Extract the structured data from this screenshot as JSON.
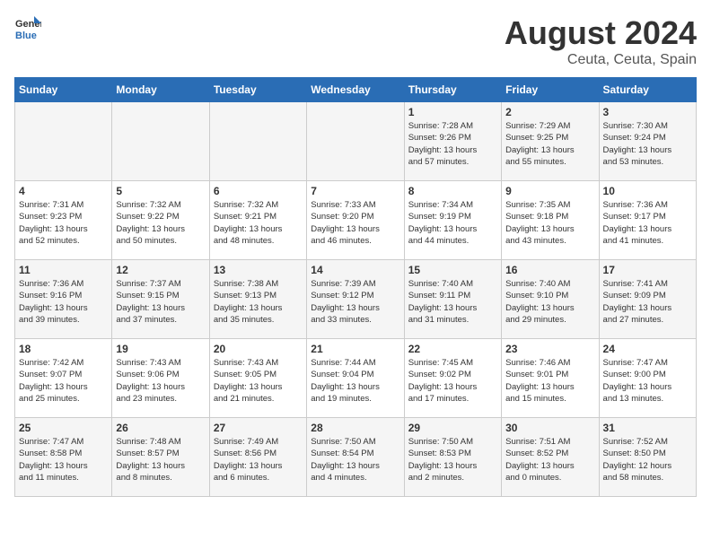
{
  "header": {
    "logo_general": "General",
    "logo_blue": "Blue",
    "month_year": "August 2024",
    "location": "Ceuta, Ceuta, Spain"
  },
  "days_of_week": [
    "Sunday",
    "Monday",
    "Tuesday",
    "Wednesday",
    "Thursday",
    "Friday",
    "Saturday"
  ],
  "weeks": [
    [
      {
        "day": "",
        "info": ""
      },
      {
        "day": "",
        "info": ""
      },
      {
        "day": "",
        "info": ""
      },
      {
        "day": "",
        "info": ""
      },
      {
        "day": "1",
        "info": "Sunrise: 7:28 AM\nSunset: 9:26 PM\nDaylight: 13 hours\nand 57 minutes."
      },
      {
        "day": "2",
        "info": "Sunrise: 7:29 AM\nSunset: 9:25 PM\nDaylight: 13 hours\nand 55 minutes."
      },
      {
        "day": "3",
        "info": "Sunrise: 7:30 AM\nSunset: 9:24 PM\nDaylight: 13 hours\nand 53 minutes."
      }
    ],
    [
      {
        "day": "4",
        "info": "Sunrise: 7:31 AM\nSunset: 9:23 PM\nDaylight: 13 hours\nand 52 minutes."
      },
      {
        "day": "5",
        "info": "Sunrise: 7:32 AM\nSunset: 9:22 PM\nDaylight: 13 hours\nand 50 minutes."
      },
      {
        "day": "6",
        "info": "Sunrise: 7:32 AM\nSunset: 9:21 PM\nDaylight: 13 hours\nand 48 minutes."
      },
      {
        "day": "7",
        "info": "Sunrise: 7:33 AM\nSunset: 9:20 PM\nDaylight: 13 hours\nand 46 minutes."
      },
      {
        "day": "8",
        "info": "Sunrise: 7:34 AM\nSunset: 9:19 PM\nDaylight: 13 hours\nand 44 minutes."
      },
      {
        "day": "9",
        "info": "Sunrise: 7:35 AM\nSunset: 9:18 PM\nDaylight: 13 hours\nand 43 minutes."
      },
      {
        "day": "10",
        "info": "Sunrise: 7:36 AM\nSunset: 9:17 PM\nDaylight: 13 hours\nand 41 minutes."
      }
    ],
    [
      {
        "day": "11",
        "info": "Sunrise: 7:36 AM\nSunset: 9:16 PM\nDaylight: 13 hours\nand 39 minutes."
      },
      {
        "day": "12",
        "info": "Sunrise: 7:37 AM\nSunset: 9:15 PM\nDaylight: 13 hours\nand 37 minutes."
      },
      {
        "day": "13",
        "info": "Sunrise: 7:38 AM\nSunset: 9:13 PM\nDaylight: 13 hours\nand 35 minutes."
      },
      {
        "day": "14",
        "info": "Sunrise: 7:39 AM\nSunset: 9:12 PM\nDaylight: 13 hours\nand 33 minutes."
      },
      {
        "day": "15",
        "info": "Sunrise: 7:40 AM\nSunset: 9:11 PM\nDaylight: 13 hours\nand 31 minutes."
      },
      {
        "day": "16",
        "info": "Sunrise: 7:40 AM\nSunset: 9:10 PM\nDaylight: 13 hours\nand 29 minutes."
      },
      {
        "day": "17",
        "info": "Sunrise: 7:41 AM\nSunset: 9:09 PM\nDaylight: 13 hours\nand 27 minutes."
      }
    ],
    [
      {
        "day": "18",
        "info": "Sunrise: 7:42 AM\nSunset: 9:07 PM\nDaylight: 13 hours\nand 25 minutes."
      },
      {
        "day": "19",
        "info": "Sunrise: 7:43 AM\nSunset: 9:06 PM\nDaylight: 13 hours\nand 23 minutes."
      },
      {
        "day": "20",
        "info": "Sunrise: 7:43 AM\nSunset: 9:05 PM\nDaylight: 13 hours\nand 21 minutes."
      },
      {
        "day": "21",
        "info": "Sunrise: 7:44 AM\nSunset: 9:04 PM\nDaylight: 13 hours\nand 19 minutes."
      },
      {
        "day": "22",
        "info": "Sunrise: 7:45 AM\nSunset: 9:02 PM\nDaylight: 13 hours\nand 17 minutes."
      },
      {
        "day": "23",
        "info": "Sunrise: 7:46 AM\nSunset: 9:01 PM\nDaylight: 13 hours\nand 15 minutes."
      },
      {
        "day": "24",
        "info": "Sunrise: 7:47 AM\nSunset: 9:00 PM\nDaylight: 13 hours\nand 13 minutes."
      }
    ],
    [
      {
        "day": "25",
        "info": "Sunrise: 7:47 AM\nSunset: 8:58 PM\nDaylight: 13 hours\nand 11 minutes."
      },
      {
        "day": "26",
        "info": "Sunrise: 7:48 AM\nSunset: 8:57 PM\nDaylight: 13 hours\nand 8 minutes."
      },
      {
        "day": "27",
        "info": "Sunrise: 7:49 AM\nSunset: 8:56 PM\nDaylight: 13 hours\nand 6 minutes."
      },
      {
        "day": "28",
        "info": "Sunrise: 7:50 AM\nSunset: 8:54 PM\nDaylight: 13 hours\nand 4 minutes."
      },
      {
        "day": "29",
        "info": "Sunrise: 7:50 AM\nSunset: 8:53 PM\nDaylight: 13 hours\nand 2 minutes."
      },
      {
        "day": "30",
        "info": "Sunrise: 7:51 AM\nSunset: 8:52 PM\nDaylight: 13 hours\nand 0 minutes."
      },
      {
        "day": "31",
        "info": "Sunrise: 7:52 AM\nSunset: 8:50 PM\nDaylight: 12 hours\nand 58 minutes."
      }
    ]
  ]
}
